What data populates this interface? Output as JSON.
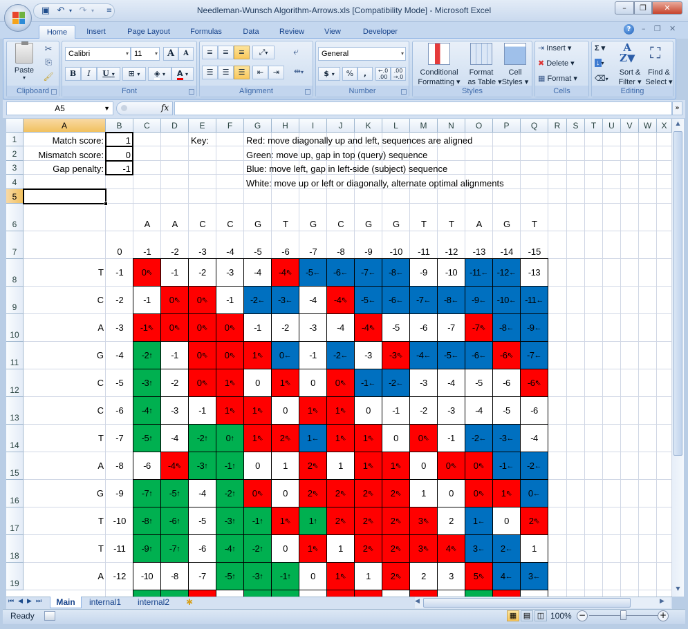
{
  "window": {
    "title": "Needleman-Wunsch Algorithm-Arrows.xls  [Compatibility Mode] - Microsoft Excel",
    "controls": {
      "minimize": "–",
      "restore": "❐",
      "close": "✕"
    }
  },
  "quick_access": [
    {
      "name": "save",
      "icon": "💾"
    },
    {
      "name": "undo",
      "icon": "↶"
    },
    {
      "name": "redo",
      "icon": "↷"
    },
    {
      "name": "customize",
      "icon": "▾"
    }
  ],
  "ribbon_tabs": [
    "Home",
    "Insert",
    "Page Layout",
    "Formulas",
    "Data",
    "Review",
    "View",
    "Developer"
  ],
  "active_ribbon_tab": "Home",
  "ribbon": {
    "clipboard": {
      "label": "Clipboard",
      "paste": "Paste"
    },
    "font": {
      "label": "Font",
      "font_name": "Calibri",
      "font_size": "11",
      "bold": "B",
      "italic": "I",
      "underline": "U",
      "grow": "A",
      "shrink": "A"
    },
    "alignment": {
      "label": "Alignment"
    },
    "number": {
      "label": "Number",
      "format": "General",
      "currency": "$",
      "percent": "%",
      "comma": ",",
      "inc_decimal": "←.0 .00",
      "dec_decimal": ".00 →.0"
    },
    "styles": {
      "label": "Styles",
      "conditional": "Conditional Formatting ▾",
      "conditional_l1": "Conditional",
      "conditional_l2": "Formatting ▾",
      "format_table_l1": "Format",
      "format_table_l2": "as Table ▾",
      "cell_styles_l1": "Cell",
      "cell_styles_l2": "Styles ▾"
    },
    "cells": {
      "label": "Cells",
      "insert": "Insert ▾",
      "delete": "Delete ▾",
      "format": "Format ▾"
    },
    "editing": {
      "label": "Editing",
      "autosum": "Σ ▾",
      "fill": "▾",
      "clear": "▾",
      "sort_l1": "Sort &",
      "sort_l2": "Filter ▾",
      "find_l1": "Find &",
      "find_l2": "Select ▾"
    }
  },
  "formula_bar": {
    "name_box": "A5",
    "fx": "fx",
    "formula": ""
  },
  "columns": [
    "A",
    "B",
    "C",
    "D",
    "E",
    "F",
    "G",
    "H",
    "I",
    "J",
    "K",
    "L",
    "M",
    "N",
    "O",
    "P",
    "Q",
    "R",
    "S",
    "T",
    "U",
    "V",
    "W",
    "X"
  ],
  "selected_cell": {
    "column": "A",
    "row": 5
  },
  "rows": [
    "1",
    "2",
    "3",
    "4",
    "5",
    "6",
    "7",
    "8",
    "9",
    "10",
    "11",
    "12",
    "13",
    "14",
    "15",
    "16",
    "17",
    "18",
    "19"
  ],
  "parameters": [
    {
      "label": "Match score:",
      "value": "1"
    },
    {
      "label": "Mismatch score:",
      "value": "0"
    },
    {
      "label": "Gap penalty:",
      "value": "-1"
    }
  ],
  "key": {
    "title": "Key:",
    "lines": [
      "Red: move diagonally up and left, sequences are aligned",
      "Green: move up, gap in top (query) sequence",
      "Blue: move left, gap in left-side (subject) sequence",
      "White: move up or left or diagonally, alternate optimal alignments"
    ]
  },
  "colors": {
    "diag": "#ff0000",
    "up": "#00b050",
    "left": "#0070c0",
    "multi": "#ffffff"
  },
  "arrows": {
    "r": "⇖",
    "g": "🡑",
    "b": "🡐",
    "w": ""
  },
  "query_sequence": [
    "A",
    "A",
    "C",
    "C",
    "G",
    "T",
    "G",
    "C",
    "G",
    "G",
    "T",
    "T",
    "A",
    "G",
    "T"
  ],
  "top_gap_row": [
    "0",
    "-1",
    "-2",
    "-3",
    "-4",
    "-5",
    "-6",
    "-7",
    "-8",
    "-9",
    "-10",
    "-11",
    "-12",
    "-13",
    "-14",
    "-15"
  ],
  "matrix": [
    {
      "base": "T",
      "gap": "-1",
      "cells": [
        [
          "0",
          "r"
        ],
        [
          "-1",
          "w"
        ],
        [
          "-2",
          "w"
        ],
        [
          "-3",
          "w"
        ],
        [
          "-4",
          "w"
        ],
        [
          "-4",
          "r"
        ],
        [
          "-5",
          "b"
        ],
        [
          "-6",
          "b"
        ],
        [
          "-7",
          "b"
        ],
        [
          "-8",
          "b"
        ],
        [
          "-9",
          "w"
        ],
        [
          "-10",
          "w"
        ],
        [
          "-11",
          "b"
        ],
        [
          "-12",
          "b"
        ],
        [
          "-13",
          "w"
        ]
      ]
    },
    {
      "base": "C",
      "gap": "-2",
      "cells": [
        [
          "-1",
          "w"
        ],
        [
          "0",
          "r"
        ],
        [
          "0",
          "r"
        ],
        [
          "-1",
          "w"
        ],
        [
          "-2",
          "b"
        ],
        [
          "-3",
          "b"
        ],
        [
          "-4",
          "w"
        ],
        [
          "-4",
          "r"
        ],
        [
          "-5",
          "b"
        ],
        [
          "-6",
          "b"
        ],
        [
          "-7",
          "b"
        ],
        [
          "-8",
          "b"
        ],
        [
          "-9",
          "b"
        ],
        [
          "-10",
          "b"
        ],
        [
          "-11",
          "b"
        ]
      ]
    },
    {
      "base": "A",
      "gap": "-3",
      "cells": [
        [
          "-1",
          "r"
        ],
        [
          "0",
          "r"
        ],
        [
          "0",
          "r"
        ],
        [
          "0",
          "r"
        ],
        [
          "-1",
          "w"
        ],
        [
          "-2",
          "w"
        ],
        [
          "-3",
          "w"
        ],
        [
          "-4",
          "w"
        ],
        [
          "-4",
          "r"
        ],
        [
          "-5",
          "w"
        ],
        [
          "-6",
          "w"
        ],
        [
          "-7",
          "w"
        ],
        [
          "-7",
          "r"
        ],
        [
          "-8",
          "b"
        ],
        [
          "-9",
          "b"
        ]
      ]
    },
    {
      "base": "G",
      "gap": "-4",
      "cells": [
        [
          "-2",
          "g"
        ],
        [
          "-1",
          "w"
        ],
        [
          "0",
          "r"
        ],
        [
          "0",
          "r"
        ],
        [
          "1",
          "r"
        ],
        [
          "0",
          "b"
        ],
        [
          "-1",
          "w"
        ],
        [
          "-2",
          "b"
        ],
        [
          "-3",
          "w"
        ],
        [
          "-3",
          "r"
        ],
        [
          "-4",
          "b"
        ],
        [
          "-5",
          "b"
        ],
        [
          "-6",
          "b"
        ],
        [
          "-6",
          "r"
        ],
        [
          "-7",
          "b"
        ]
      ]
    },
    {
      "base": "C",
      "gap": "-5",
      "cells": [
        [
          "-3",
          "g"
        ],
        [
          "-2",
          "w"
        ],
        [
          "0",
          "r"
        ],
        [
          "1",
          "r"
        ],
        [
          "0",
          "w"
        ],
        [
          "1",
          "r"
        ],
        [
          "0",
          "w"
        ],
        [
          "0",
          "r"
        ],
        [
          "-1",
          "b"
        ],
        [
          "-2",
          "b"
        ],
        [
          "-3",
          "w"
        ],
        [
          "-4",
          "w"
        ],
        [
          "-5",
          "w"
        ],
        [
          "-6",
          "w"
        ],
        [
          "-6",
          "r"
        ]
      ]
    },
    {
      "base": "C",
      "gap": "-6",
      "cells": [
        [
          "-4",
          "g"
        ],
        [
          "-3",
          "w"
        ],
        [
          "-1",
          "w"
        ],
        [
          "1",
          "r"
        ],
        [
          "1",
          "r"
        ],
        [
          "0",
          "w"
        ],
        [
          "1",
          "r"
        ],
        [
          "1",
          "r"
        ],
        [
          "0",
          "w"
        ],
        [
          "-1",
          "w"
        ],
        [
          "-2",
          "w"
        ],
        [
          "-3",
          "w"
        ],
        [
          "-4",
          "w"
        ],
        [
          "-5",
          "w"
        ],
        [
          "-6",
          "w"
        ]
      ]
    },
    {
      "base": "T",
      "gap": "-7",
      "cells": [
        [
          "-5",
          "g"
        ],
        [
          "-4",
          "w"
        ],
        [
          "-2",
          "g"
        ],
        [
          "0",
          "g"
        ],
        [
          "1",
          "r"
        ],
        [
          "2",
          "r"
        ],
        [
          "1",
          "b"
        ],
        [
          "1",
          "r"
        ],
        [
          "1",
          "r"
        ],
        [
          "0",
          "w"
        ],
        [
          "0",
          "r"
        ],
        [
          "-1",
          "w"
        ],
        [
          "-2",
          "b"
        ],
        [
          "-3",
          "b"
        ],
        [
          "-4",
          "w"
        ]
      ]
    },
    {
      "base": "A",
      "gap": "-8",
      "cells": [
        [
          "-6",
          "w"
        ],
        [
          "-4",
          "r"
        ],
        [
          "-3",
          "g"
        ],
        [
          "-1",
          "g"
        ],
        [
          "0",
          "w"
        ],
        [
          "1",
          "w"
        ],
        [
          "2",
          "r"
        ],
        [
          "1",
          "w"
        ],
        [
          "1",
          "r"
        ],
        [
          "1",
          "r"
        ],
        [
          "0",
          "w"
        ],
        [
          "0",
          "r"
        ],
        [
          "0",
          "r"
        ],
        [
          "-1",
          "b"
        ],
        [
          "-2",
          "b"
        ]
      ]
    },
    {
      "base": "G",
      "gap": "-9",
      "cells": [
        [
          "-7",
          "g"
        ],
        [
          "-5",
          "g"
        ],
        [
          "-4",
          "w"
        ],
        [
          "-2",
          "g"
        ],
        [
          "0",
          "r"
        ],
        [
          "0",
          "w"
        ],
        [
          "2",
          "r"
        ],
        [
          "2",
          "r"
        ],
        [
          "2",
          "r"
        ],
        [
          "2",
          "r"
        ],
        [
          "1",
          "w"
        ],
        [
          "0",
          "w"
        ],
        [
          "0",
          "r"
        ],
        [
          "1",
          "r"
        ],
        [
          "0",
          "b"
        ]
      ]
    },
    {
      "base": "T",
      "gap": "-10",
      "cells": [
        [
          "-8",
          "g"
        ],
        [
          "-6",
          "g"
        ],
        [
          "-5",
          "w"
        ],
        [
          "-3",
          "g"
        ],
        [
          "-1",
          "g"
        ],
        [
          "1",
          "r"
        ],
        [
          "1",
          "g"
        ],
        [
          "2",
          "r"
        ],
        [
          "2",
          "r"
        ],
        [
          "2",
          "r"
        ],
        [
          "3",
          "r"
        ],
        [
          "2",
          "w"
        ],
        [
          "1",
          "b"
        ],
        [
          "0",
          "w"
        ],
        [
          "2",
          "r"
        ]
      ]
    },
    {
      "base": "T",
      "gap": "-11",
      "cells": [
        [
          "-9",
          "g"
        ],
        [
          "-7",
          "g"
        ],
        [
          "-6",
          "w"
        ],
        [
          "-4",
          "g"
        ],
        [
          "-2",
          "g"
        ],
        [
          "0",
          "w"
        ],
        [
          "1",
          "r"
        ],
        [
          "1",
          "w"
        ],
        [
          "2",
          "r"
        ],
        [
          "2",
          "r"
        ],
        [
          "3",
          "r"
        ],
        [
          "4",
          "r"
        ],
        [
          "3",
          "b"
        ],
        [
          "2",
          "b"
        ],
        [
          "1",
          "w"
        ]
      ]
    },
    {
      "base": "A",
      "gap": "-12",
      "cells": [
        [
          "-10",
          "w"
        ],
        [
          "-8",
          "w"
        ],
        [
          "-7",
          "w"
        ],
        [
          "-5",
          "g"
        ],
        [
          "-3",
          "g"
        ],
        [
          "-1",
          "g"
        ],
        [
          "0",
          "w"
        ],
        [
          "1",
          "r"
        ],
        [
          "1",
          "w"
        ],
        [
          "2",
          "r"
        ],
        [
          "2",
          "w"
        ],
        [
          "3",
          "w"
        ],
        [
          "5",
          "r"
        ],
        [
          "4",
          "b"
        ],
        [
          "3",
          "b"
        ]
      ]
    }
  ],
  "partial_row_colors": [
    "g",
    "g",
    "r",
    "w",
    "g",
    "g",
    "w",
    "r",
    "r",
    "w",
    "r",
    "w",
    "g",
    "r",
    "w"
  ],
  "sheet_tabs": [
    "Main",
    "internal1",
    "internal2"
  ],
  "active_sheet": "Main",
  "status": {
    "text": "Ready",
    "zoom": "100%"
  }
}
